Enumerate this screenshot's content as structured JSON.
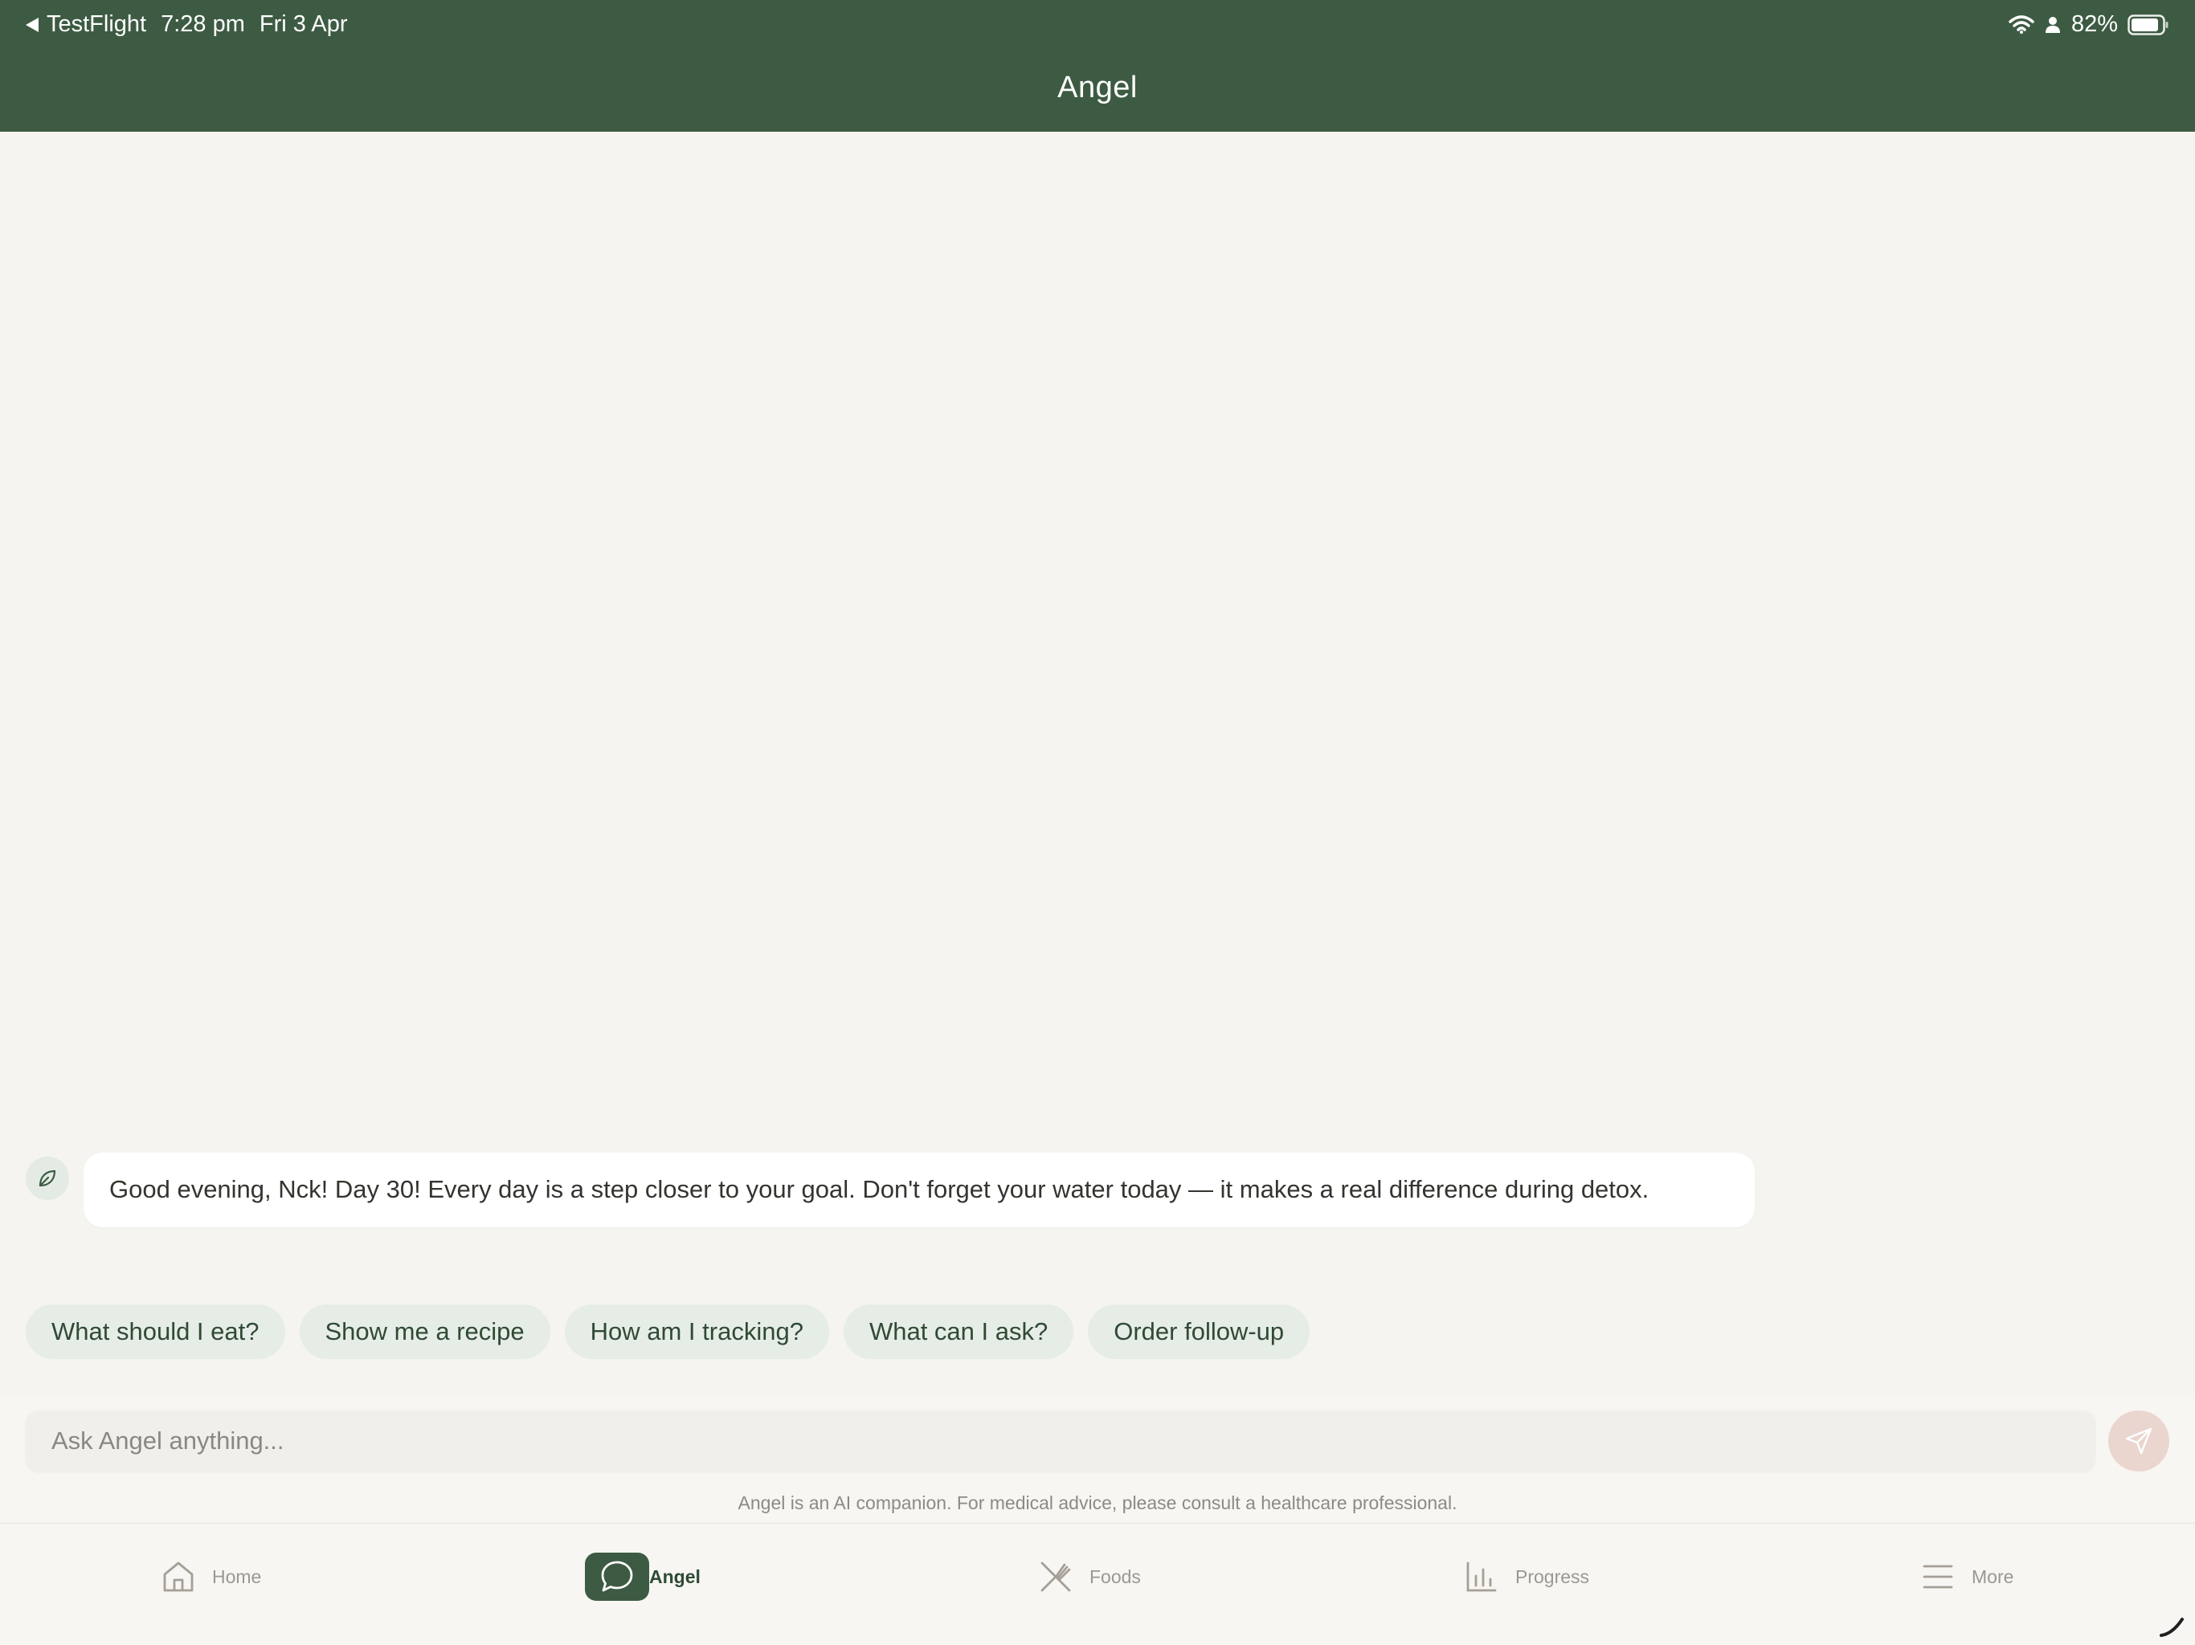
{
  "status_bar": {
    "back_app": "TestFlight",
    "time": "7:28 pm",
    "date": "Fri 3 Apr",
    "battery": "82%"
  },
  "header": {
    "title": "Angel"
  },
  "chat": {
    "message": "Good evening, Nck! Day 30! Every day is a step closer to your goal. Don't forget your water today — it makes a real difference during detox."
  },
  "chips": [
    "What should I eat?",
    "Show me a recipe",
    "How am I tracking?",
    "What can I ask?",
    "Order follow-up"
  ],
  "input": {
    "placeholder": "Ask Angel anything...",
    "disclaimer": "Angel is an AI companion. For medical advice, please consult a healthcare professional."
  },
  "tabs": [
    {
      "label": "Home",
      "icon": "home-icon"
    },
    {
      "label": "Angel",
      "icon": "chat-bubble-icon",
      "active": true
    },
    {
      "label": "Foods",
      "icon": "utensils-icon"
    },
    {
      "label": "Progress",
      "icon": "bar-chart-icon"
    },
    {
      "label": "More",
      "icon": "menu-icon"
    }
  ],
  "colors": {
    "header": "#3d5b43",
    "background": "#f5f4f0",
    "chip_bg": "#e6ece6",
    "chip_text": "#2f4a35",
    "send_button": "#ead6cf"
  }
}
